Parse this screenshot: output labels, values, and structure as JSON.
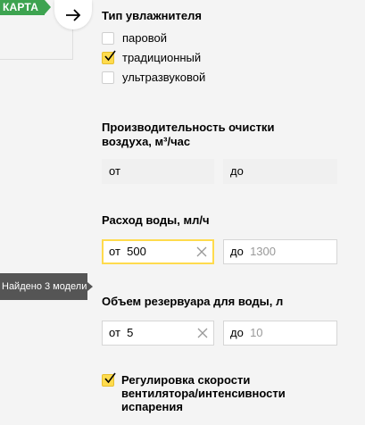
{
  "map_badge": {
    "label": "КАРТА"
  },
  "humidifier_type": {
    "title": "Тип увлажнителя",
    "options": [
      {
        "label": "паровой",
        "checked": false
      },
      {
        "label": "традиционный",
        "checked": true
      },
      {
        "label": "ультразвуковой",
        "checked": false
      }
    ]
  },
  "air_cleaning": {
    "title_line1": "Производительность очистки",
    "title_line2": "воздуха, м³/час",
    "from_placeholder": "от",
    "to_placeholder": "до"
  },
  "water_flow": {
    "title": "Расход воды, мл/ч",
    "from_prefix": "от",
    "from_value": "500",
    "to_prefix": "до",
    "to_placeholder": "1300"
  },
  "tank_volume": {
    "title": "Объем резервуара для воды, л",
    "from_prefix": "от",
    "from_value": "5",
    "to_prefix": "до",
    "to_placeholder": "10"
  },
  "fan_speed_control": {
    "label_line1": "Регулировка скорости",
    "label_line2": "вентилятора/интенсивности",
    "label_line3": "испарения",
    "checked": true
  },
  "tooltip": {
    "text": "Найдено 3 модели"
  },
  "colors": {
    "accent": "#ffdb4d",
    "map_green": "#3da350",
    "tooltip_bg": "#555555"
  }
}
